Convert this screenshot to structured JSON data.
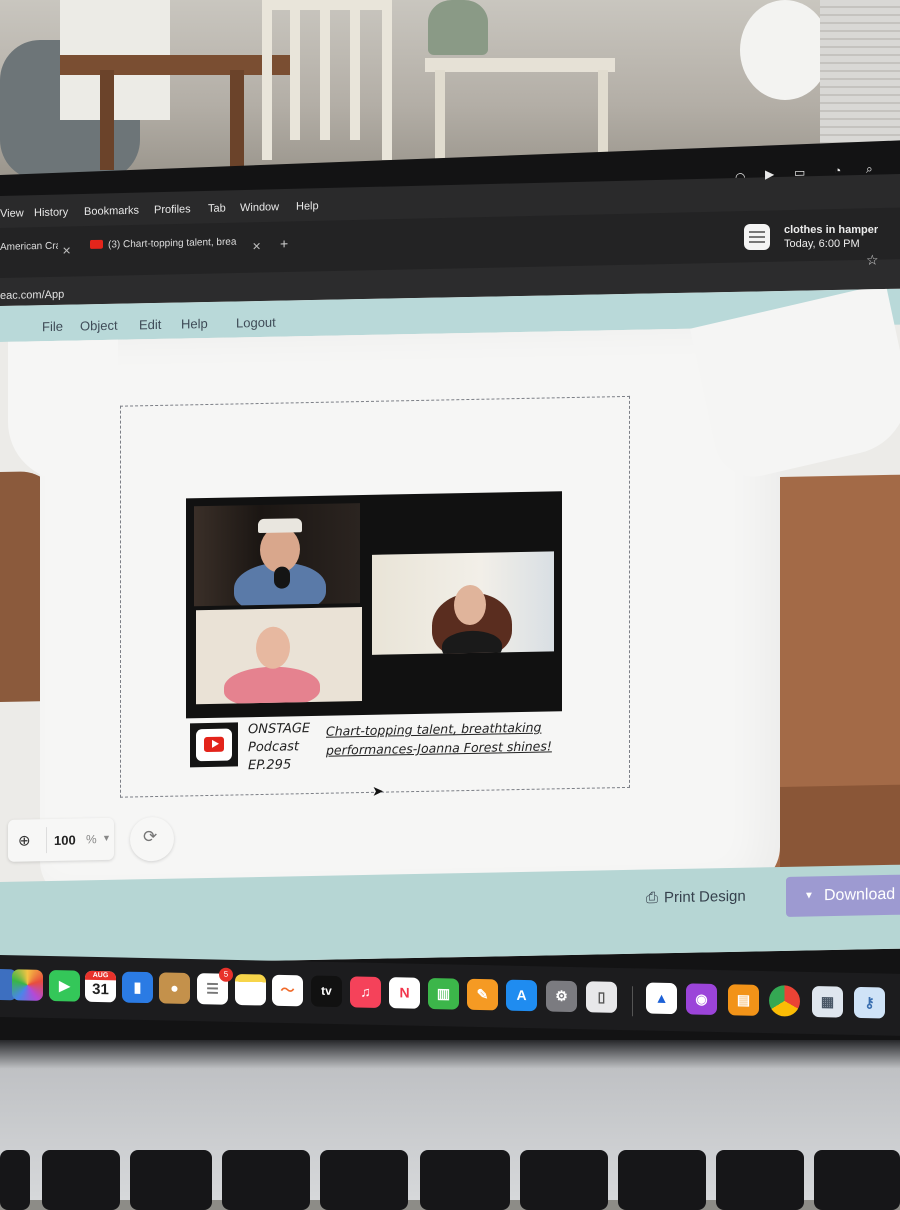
{
  "menubar": {
    "items": [
      "View",
      "History",
      "Bookmarks",
      "Profiles",
      "Tab",
      "Window",
      "Help"
    ]
  },
  "notification": {
    "title": "clothes in hamper",
    "time": "Today, 6:00 PM"
  },
  "tabs": [
    {
      "label": "American Craft"
    },
    {
      "label": "(3) Chart-topping talent, brea"
    }
  ],
  "address": {
    "url": "eac.com/App"
  },
  "app_menu": [
    "File",
    "Object",
    "Edit",
    "Help",
    "Logout"
  ],
  "design": {
    "episode_lines": [
      "ONSTAGE",
      "Podcast",
      "EP.295"
    ],
    "caption_line1": "Chart-topping talent, breathtaking",
    "caption_line2": "performances-Joanna Forest shines!"
  },
  "zoom": {
    "value": "100",
    "unit": "%"
  },
  "footer": {
    "print_label": "Print Design",
    "download_label": "Download"
  },
  "dock": {
    "calendar_month": "AUG",
    "calendar_day": "31",
    "reminders_badge": "5",
    "tv_label": "tv"
  },
  "colors": {
    "app_header": "#b9d9d9",
    "app_footer": "#b6d6d4",
    "download_button": "#9d9ad1",
    "youtube_red": "#e3241b"
  }
}
